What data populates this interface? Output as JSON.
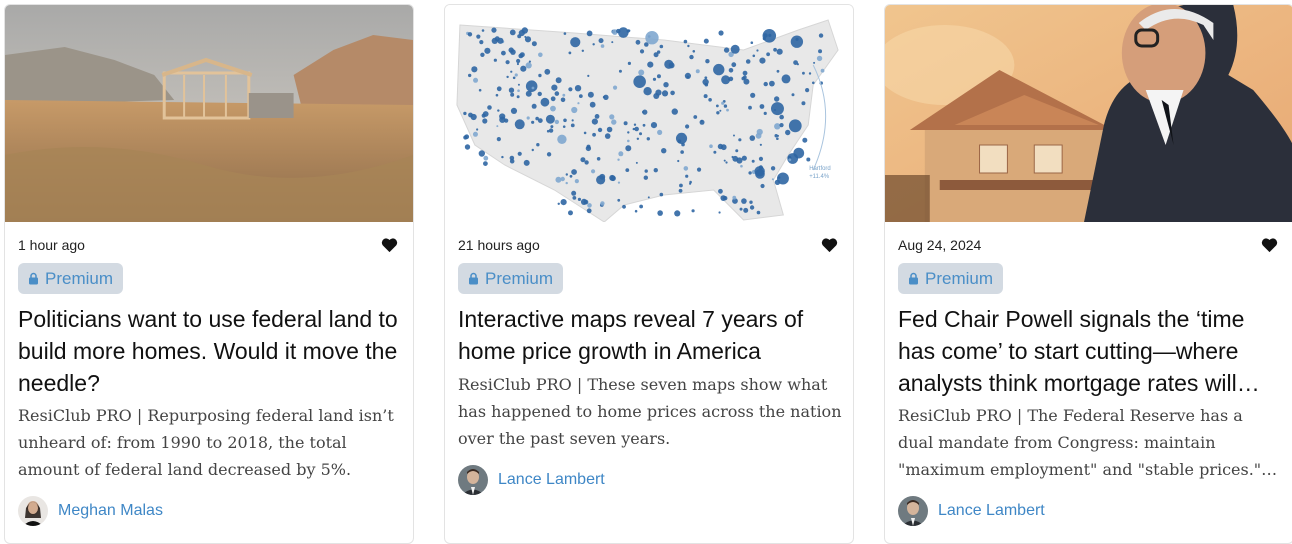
{
  "cards": [
    {
      "time": "1 hour ago",
      "badge": "Premium",
      "title": "Politicians want to use federal land to build more homes. Would it move the needle?",
      "description": "ResiClub PRO | Repurposing federal land isn’t unheard of: from 1990 to 2018, the total amount of federal land decreased by 5%.",
      "author": "Meghan Malas",
      "image": "desert-construction-house"
    },
    {
      "time": "21 hours ago",
      "badge": "Premium",
      "title": "Interactive maps reveal 7 years of home price growth in America",
      "description": "ResiClub PRO | These seven maps show what has happened to home prices across the nation over the past seven years.",
      "author": "Lance Lambert",
      "image": "us-bubble-map",
      "map_label_city": "Hartford",
      "map_label_value": "+11.4%"
    },
    {
      "time": "Aug 24, 2024",
      "badge": "Premium",
      "title": "Fed Chair Powell signals the ‘time has come’ to start cutting—where analysts think mortgage rates will head next",
      "description": "ResiClub PRO | The Federal Reserve has a dual mandate from Congress: maintain \"maximum employment\" and \"stable prices.\" The focus is on inflation as cuts begin.",
      "author": "Lance Lambert",
      "image": "man-and-house-illustration"
    }
  ],
  "colors": {
    "accent": "#3f87c6",
    "badge_bg": "#d3dae2"
  }
}
